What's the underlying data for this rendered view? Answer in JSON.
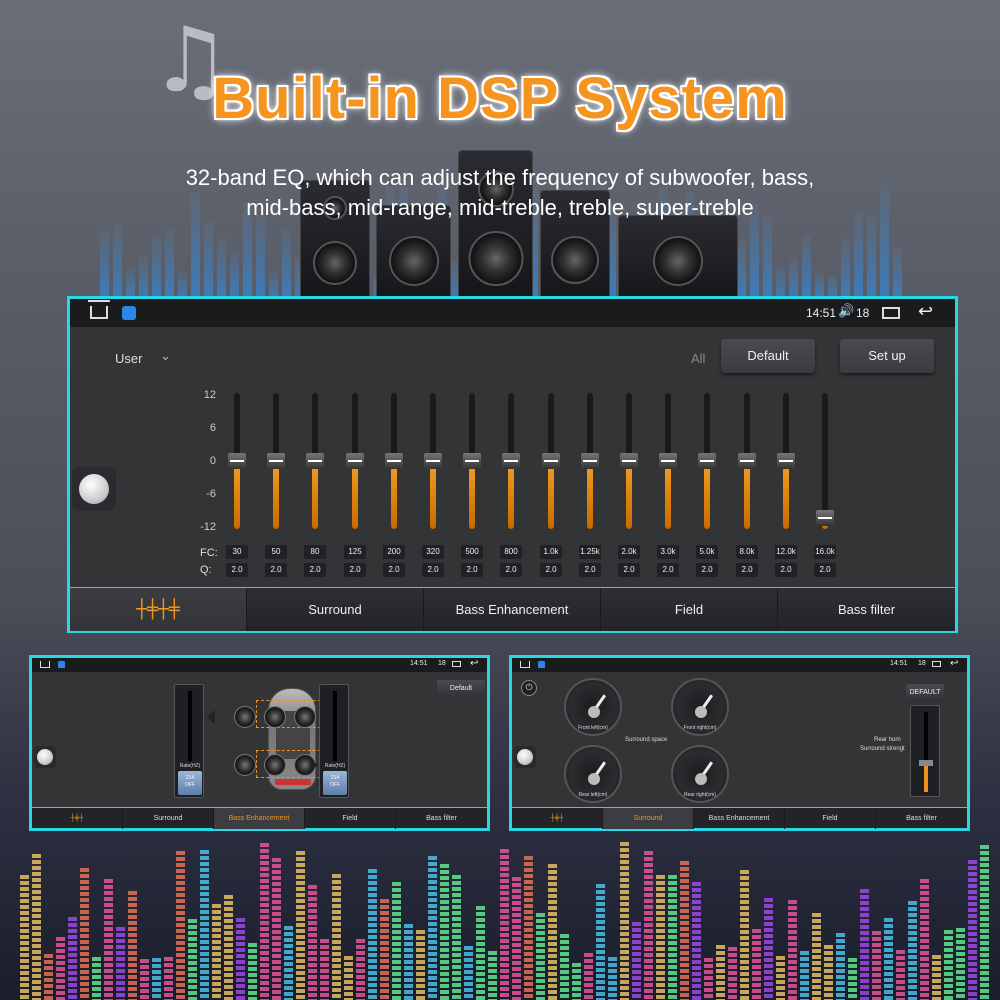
{
  "headline": "Built-in DSP System",
  "subtitle": {
    "line1": "32-band EQ, which can adjust the frequency of subwoofer, bass,",
    "line2": "mid-bass, mid-range, mid-treble, treble, super-treble"
  },
  "main_screen": {
    "status": {
      "time": "14:51",
      "volume": "18"
    },
    "preset": "User",
    "all_label": "All",
    "default_button": "Default",
    "setup_button": "Set up",
    "y_axis_labels": [
      "12",
      "6",
      "0",
      "-6",
      "-12"
    ],
    "fc_label": "FC:",
    "q_label": "Q:",
    "bands": [
      {
        "fc": "30",
        "q": "2.0",
        "gain": 0
      },
      {
        "fc": "50",
        "q": "2.0",
        "gain": 0
      },
      {
        "fc": "80",
        "q": "2.0",
        "gain": 0
      },
      {
        "fc": "125",
        "q": "2.0",
        "gain": 0
      },
      {
        "fc": "200",
        "q": "2.0",
        "gain": 0
      },
      {
        "fc": "320",
        "q": "2.0",
        "gain": 0
      },
      {
        "fc": "500",
        "q": "2.0",
        "gain": 0
      },
      {
        "fc": "800",
        "q": "2.0",
        "gain": 0
      },
      {
        "fc": "1.0k",
        "q": "2.0",
        "gain": 0
      },
      {
        "fc": "1.25k",
        "q": "2.0",
        "gain": 0
      },
      {
        "fc": "2.0k",
        "q": "2.0",
        "gain": 0
      },
      {
        "fc": "3.0k",
        "q": "2.0",
        "gain": 0
      },
      {
        "fc": "5.0k",
        "q": "2.0",
        "gain": 0
      },
      {
        "fc": "8.0k",
        "q": "2.0",
        "gain": 0
      },
      {
        "fc": "12.0k",
        "q": "2.0",
        "gain": 0
      },
      {
        "fc": "16.0k",
        "q": "2.0",
        "gain": -10
      }
    ],
    "tabs": [
      "Surround",
      "Bass Enhancement",
      "Field",
      "Bass filter"
    ],
    "accent_color": "#f5941e",
    "frame_color": "#28d6e6"
  },
  "left_mini": {
    "status": {
      "time": "14:51",
      "volume": "18"
    },
    "default_button": "Default",
    "left_slider": {
      "label": "Rate(HZ)",
      "value": "214",
      "state": "OFF"
    },
    "right_slider": {
      "label": "Rate(HZ)",
      "value": "214",
      "state": "OFF"
    },
    "tabs": [
      "Surround",
      "Bass Enhancement",
      "Field",
      "Bass filter"
    ],
    "active_tab": "Bass Enhancement"
  },
  "right_mini": {
    "status": {
      "time": "14:51",
      "volume": "18"
    },
    "default_button": "DEFAULT",
    "surround_space_label": "Surround space",
    "rear_horn_label": "Rear horn",
    "surround_strength_label": "Surround strengt",
    "dials": [
      "Front left(cm)",
      "Front right(cm)",
      "Rear left(cm)",
      "Rear right(cm)"
    ],
    "tabs": [
      "Surround",
      "Bass Enhancement",
      "Field",
      "Bass filter"
    ],
    "active_tab": "Surround"
  }
}
